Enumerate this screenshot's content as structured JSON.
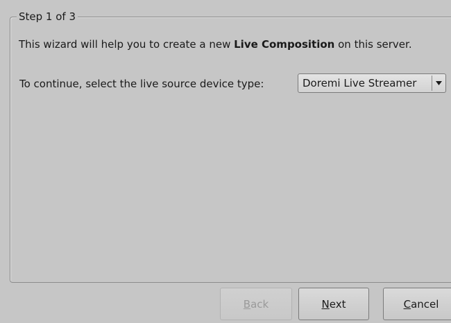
{
  "wizard": {
    "step_label": "Step 1 of 3",
    "intro": {
      "prefix": "This wizard will help you to create a new ",
      "emphasis": "Live Composition",
      "suffix": " on this server."
    },
    "prompt": "To continue, select the live source device type:",
    "device_type": {
      "selected": "Doremi Live Streamer"
    }
  },
  "buttons": {
    "back": {
      "mnemonic": "B",
      "rest": "ack",
      "enabled": false
    },
    "next": {
      "mnemonic": "N",
      "rest": "ext",
      "enabled": true
    },
    "cancel": {
      "mnemonic": "C",
      "rest": "ancel",
      "enabled": true
    }
  }
}
